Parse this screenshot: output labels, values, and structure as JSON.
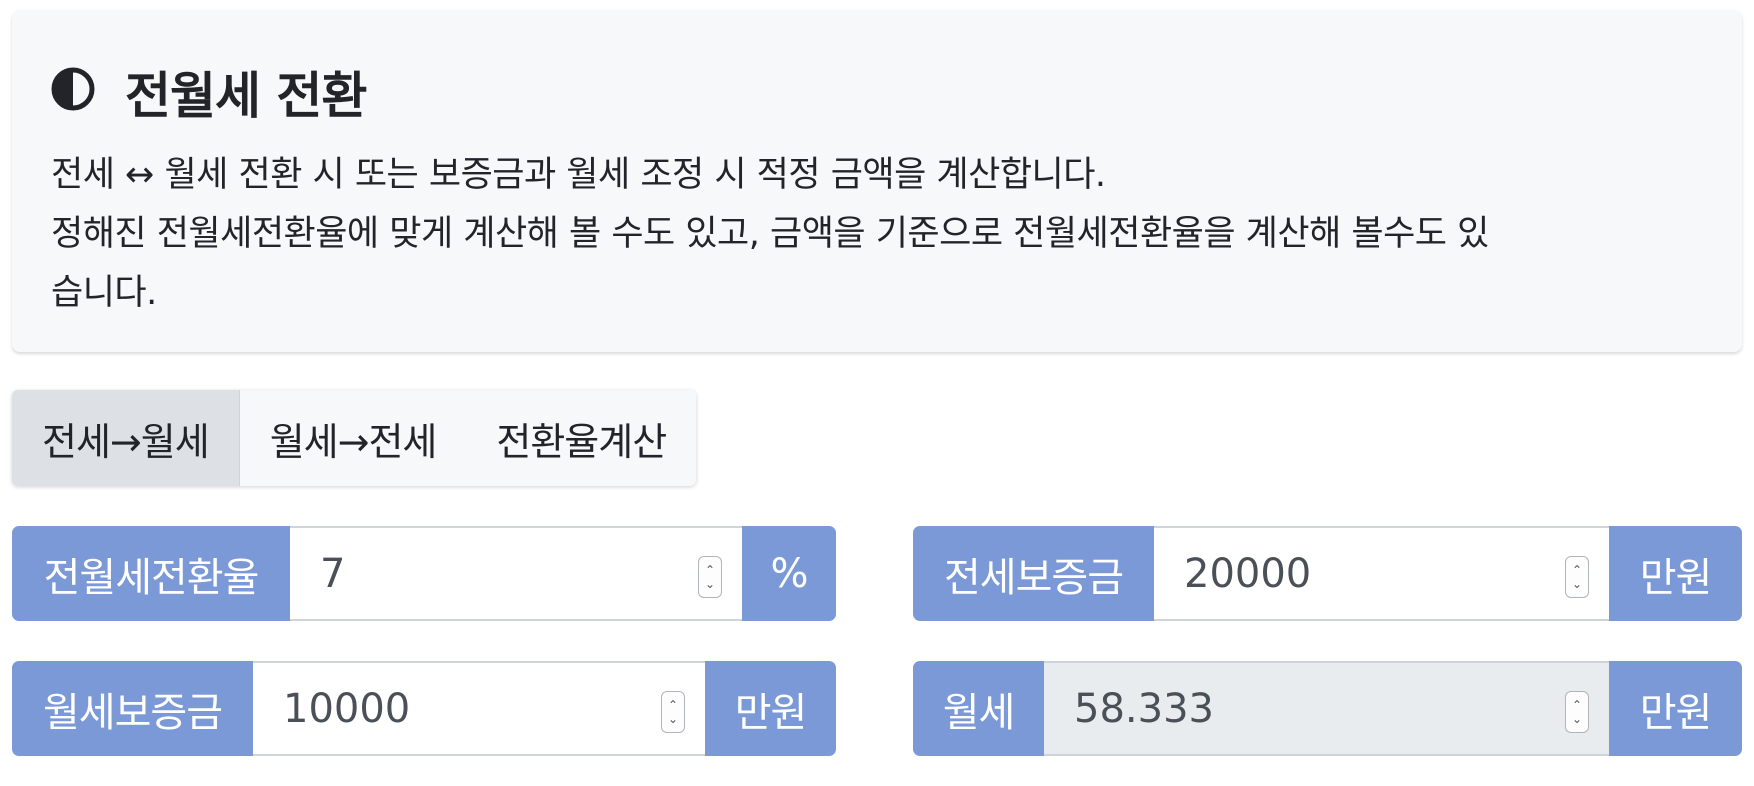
{
  "header": {
    "icon": "half-circle-icon",
    "title": "전월세 전환",
    "description_line1": "전세 ↔ 월세 전환 시 또는 보증금과 월세 조정 시 적정 금액을 계산합니다.",
    "description_line2": "정해진 전월세전환율에 맞게 계산해 볼 수도 있고, 금액을 기준으로 전월세전환율을 계산해 볼수도 있",
    "description_line3": "습니다."
  },
  "tabs": [
    {
      "label": "전세→월세",
      "active": true
    },
    {
      "label": "월세→전세",
      "active": false
    },
    {
      "label": "전환율계산",
      "active": false
    }
  ],
  "fields": {
    "rate": {
      "label": "전월세전환율",
      "value": "7",
      "unit": "%"
    },
    "jeonse_deposit": {
      "label": "전세보증금",
      "value": "20000",
      "unit": "만원"
    },
    "monthly_deposit": {
      "label": "월세보증금",
      "value": "10000",
      "unit": "만원"
    },
    "monthly_rent": {
      "label": "월세",
      "value": "58.333",
      "unit": "만원",
      "readonly": true
    }
  },
  "colors": {
    "addon": "#7b99d6",
    "card_bg": "#f7f8fa",
    "active_tab": "#dde1e6",
    "readonly_bg": "#e9ecef"
  }
}
